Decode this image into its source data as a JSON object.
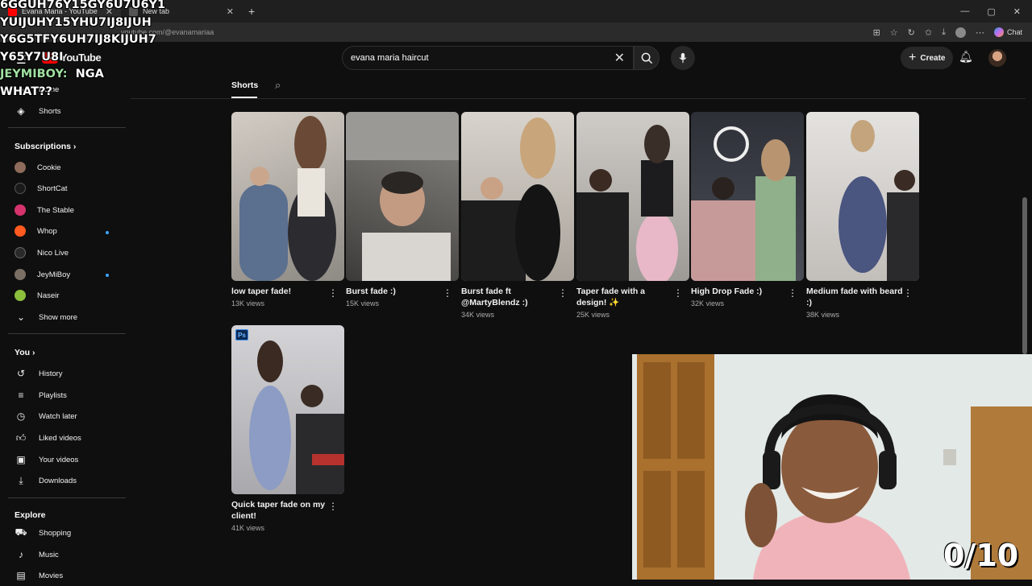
{
  "browser": {
    "tabs": [
      {
        "label": "Evana Maria - YouTube",
        "active": true
      },
      {
        "label": "New tab",
        "active": false
      }
    ],
    "url": "youtube.com/@evanamariaa",
    "chat_label": "Chat"
  },
  "overlay": {
    "lines": [
      "6GGUH76Y15GY6U7U6Y1",
      "YUIJUHY15YHU7IJ8IJUH",
      "Y6G5TFY6UH7IJ8KIJUH7",
      "Y65Y7U8I"
    ],
    "speaker": "JEYMIBOY:",
    "message1": "NGA",
    "message2": "WHAT??"
  },
  "header": {
    "logo": "YouTube",
    "search_value": "evana maria haircut",
    "create_label": "Create"
  },
  "sidebar": {
    "home": "Home",
    "shorts": "Shorts",
    "subscriptions_title": "Subscriptions",
    "subscriptions": [
      {
        "name": "Cookie",
        "color": "#8e6b5a",
        "new": false
      },
      {
        "name": "ShortCat",
        "color": "#1a1a1a",
        "new": false
      },
      {
        "name": "The Stable",
        "color": "#d6336c",
        "new": false
      },
      {
        "name": "Whop",
        "color": "#ff5a1f",
        "new": true
      },
      {
        "name": "Nico Live",
        "color": "#2a2a2a",
        "new": false
      },
      {
        "name": "JeyMiBoy",
        "color": "#7a6f65",
        "new": true
      },
      {
        "name": "Naseir",
        "color": "#8bbf3c",
        "new": false
      }
    ],
    "show_more": "Show more",
    "you_title": "You",
    "you_items": [
      "History",
      "Playlists",
      "Watch later",
      "Liked videos",
      "Your videos",
      "Downloads"
    ],
    "explore_title": "Explore",
    "explore_items": [
      "Shopping",
      "Music",
      "Movies"
    ]
  },
  "content": {
    "tab_label": "Shorts",
    "shorts": [
      {
        "title": "low taper fade!",
        "views": "13K views",
        "bg": "#b9b2aa",
        "accent": "#5b6f8f"
      },
      {
        "title": "Burst fade :)",
        "views": "15K views",
        "bg": "#6b6966",
        "accent": "#3c3a38"
      },
      {
        "title": "Burst fade ft @MartyBlendz :)",
        "views": "34K views",
        "bg": "#cfcac2",
        "accent": "#1d1d1d"
      },
      {
        "title": "Taper fade with a design! ✨",
        "views": "25K views",
        "bg": "#b7b4b0",
        "accent": "#e8b8c8"
      },
      {
        "title": "High Drop Fade :)",
        "views": "32K views",
        "bg": "#3c3f47",
        "accent": "#8fb08a"
      },
      {
        "title": "Medium fade with beard :)",
        "views": "38K views",
        "bg": "#d8d5d2",
        "accent": "#4a5580"
      },
      {
        "title": "Quick taper fade on my client!",
        "views": "41K views",
        "bg": "#c9c9cc",
        "accent": "#8c9cc4"
      }
    ]
  },
  "webcam": {
    "score": "0/10"
  }
}
